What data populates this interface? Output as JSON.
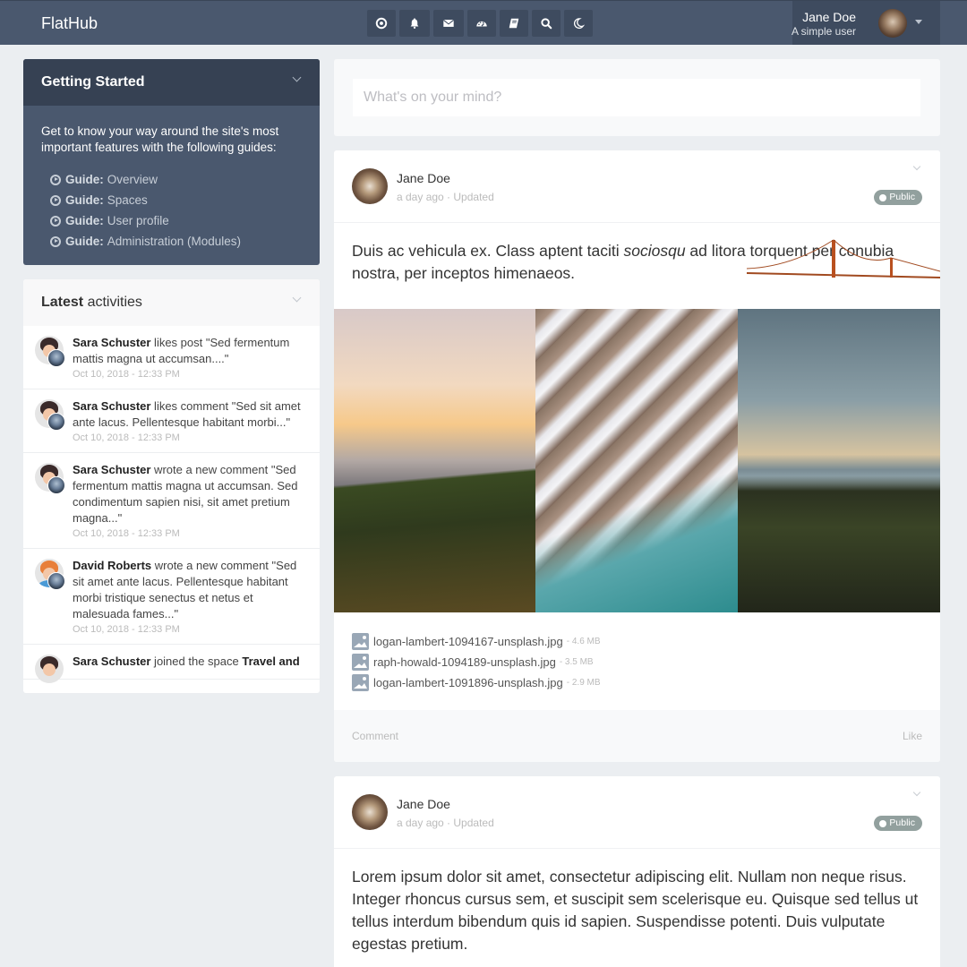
{
  "app": {
    "brand": "FlatHub"
  },
  "topbar": {
    "icons": [
      "target-icon",
      "bell-icon",
      "envelope-icon",
      "dashboard-icon",
      "book-icon",
      "search-icon",
      "moon-icon"
    ],
    "user": {
      "name": "Jane Doe",
      "subtitle": "A simple user"
    }
  },
  "getting_started": {
    "title": "Getting Started",
    "intro": "Get to know your way around the site's most important features with the following guides:",
    "guide_prefix": "Guide:",
    "guides": [
      {
        "label": "Overview"
      },
      {
        "label": "Spaces"
      },
      {
        "label": "User profile"
      },
      {
        "label": "Administration (Modules)"
      }
    ]
  },
  "latest_activities": {
    "title_bold": "Latest",
    "title_rest": " activities",
    "items": [
      {
        "user": "Sara Schuster",
        "text": " likes post \"Sed fermentum mattis magna ut accumsan....\"",
        "time": "Oct 10, 2018 - 12:33 PM"
      },
      {
        "user": "Sara Schuster",
        "text": " likes comment \"Sed sit amet ante lacus. Pellentesque habitant morbi...\"",
        "time": "Oct 10, 2018 - 12:33 PM"
      },
      {
        "user": "Sara Schuster",
        "text": " wrote a new comment \"Sed fermentum mattis magna ut accumsan. Sed condimentum sapien nisi, sit amet pretium magna...\"",
        "time": "Oct 10, 2018 - 12:33 PM"
      },
      {
        "user": "David Roberts",
        "text": " wrote a new comment \"Sed sit amet ante lacus. Pellentesque habitant morbi tristique senectus et netus et malesuada fames...\"",
        "time": "Oct 10, 2018 - 12:33 PM"
      },
      {
        "user": "Sara Schuster",
        "text": " joined the space ",
        "space": "Travel and",
        "time": ""
      }
    ]
  },
  "composer": {
    "placeholder": "What's on your mind?",
    "value": ""
  },
  "posts": [
    {
      "author": "Jane Doe",
      "meta": "a day ago · Updated",
      "visibility": "Public",
      "body_before": "Duis ac vehicula ex. Class aptent taciti ",
      "body_em": "sociosqu",
      "body_after": " ad litora torquent per conubia nostra, per inceptos himenaeos.",
      "photos": [
        "mountain-sunset-photo",
        "aerial-waves-photo",
        "golden-gate-bridge-photo"
      ],
      "files": [
        {
          "name": "logan-lambert-1094167-unsplash.jpg",
          "size": "- 4.6 MB"
        },
        {
          "name": "raph-howald-1094189-unsplash.jpg",
          "size": "- 3.5 MB"
        },
        {
          "name": "logan-lambert-1091896-unsplash.jpg",
          "size": "- 2.9 MB"
        }
      ],
      "actions": {
        "comment": "Comment",
        "like": "Like"
      }
    },
    {
      "author": "Jane Doe",
      "meta": "a day ago · Updated",
      "visibility": "Public",
      "body": "Lorem ipsum dolor sit amet, consectetur adipiscing elit. Nullam non neque risus. Integer rhoncus cursus sem, et suscipit sem scelerisque eu. Quisque sed tellus ut tellus interdum bibendum quis id sapien. Suspendisse potenti. Duis vulputate egestas pretium."
    }
  ]
}
